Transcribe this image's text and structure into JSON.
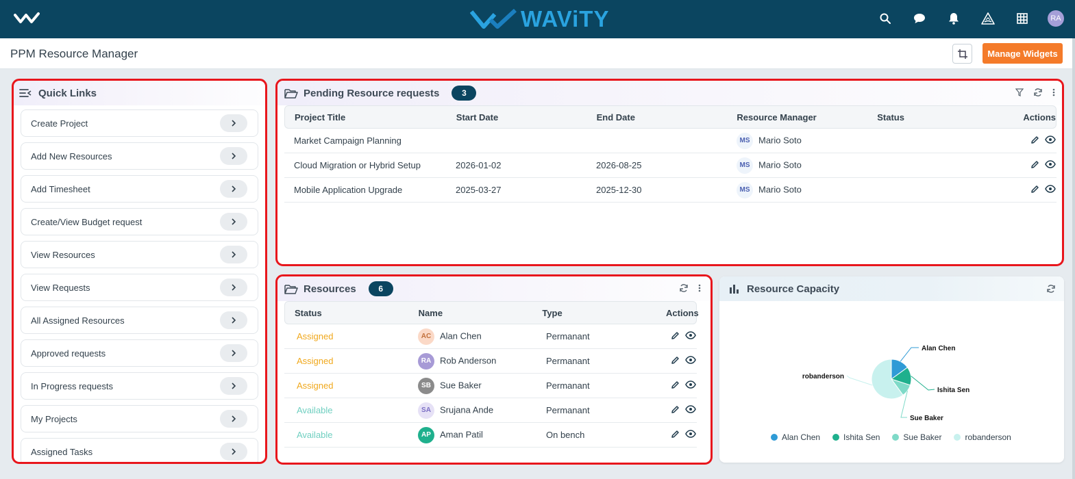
{
  "brand": {
    "name": "WAViTY"
  },
  "topbar": {
    "avatar_initials": "RA"
  },
  "header": {
    "title": "PPM Resource Manager",
    "manage_widgets_label": "Manage Widgets"
  },
  "quick_links": {
    "title": "Quick Links",
    "items": [
      {
        "label": "Create Project"
      },
      {
        "label": "Add New Resources"
      },
      {
        "label": "Add Timesheet"
      },
      {
        "label": "Create/View Budget request"
      },
      {
        "label": "View Resources"
      },
      {
        "label": "View Requests"
      },
      {
        "label": "All Assigned Resources"
      },
      {
        "label": "Approved requests"
      },
      {
        "label": "In Progress requests"
      },
      {
        "label": "My Projects"
      },
      {
        "label": "Assigned Tasks"
      }
    ]
  },
  "pending": {
    "title": "Pending Resource requests",
    "count": "3",
    "columns": [
      "Project Title",
      "Start Date",
      "End Date",
      "Resource Manager",
      "Status",
      "Actions"
    ],
    "rows": [
      {
        "title": "Market Campaign Planning",
        "start": "",
        "end": "",
        "manager_initials": "MS",
        "manager": "Mario Soto",
        "status": ""
      },
      {
        "title": "Cloud Migration or Hybrid Setup",
        "start": "2026-01-02",
        "end": "2026-08-25",
        "manager_initials": "MS",
        "manager": "Mario Soto",
        "status": ""
      },
      {
        "title": "Mobile Application Upgrade",
        "start": "2025-03-27",
        "end": "2025-12-30",
        "manager_initials": "MS",
        "manager": "Mario Soto",
        "status": ""
      }
    ]
  },
  "resources": {
    "title": "Resources",
    "count": "6",
    "columns": [
      "Status",
      "Name",
      "Type",
      "Actions"
    ],
    "rows": [
      {
        "status": "Assigned",
        "initials": "AC",
        "name": "Alan Chen",
        "type": "Permanant"
      },
      {
        "status": "Assigned",
        "initials": "RA",
        "name": "Rob Anderson",
        "type": "Permanant"
      },
      {
        "status": "Assigned",
        "initials": "SB",
        "name": "Sue Baker",
        "type": "Permanant"
      },
      {
        "status": "Available",
        "initials": "SA",
        "name": "Srujana Ande",
        "type": "Permanant"
      },
      {
        "status": "Available",
        "initials": "AP",
        "name": "Aman Patil",
        "type": "On bench"
      }
    ]
  },
  "capacity": {
    "title": "Resource Capacity",
    "chart_data": {
      "type": "pie",
      "title": "",
      "categories": [
        "Alan Chen",
        "Ishita Sen",
        "Sue Baker",
        "robanderson"
      ],
      "values": [
        15,
        15,
        10,
        60
      ],
      "colors": [
        "#2f9bd6",
        "#1fb08d",
        "#7fdac8",
        "#c8f1ee"
      ],
      "legend": "bottom"
    }
  },
  "colors": {
    "assigned": "#f0a81c",
    "available": "#6fcfc0",
    "brand_dark": "#0b4560",
    "accent": "#f47b2a"
  }
}
